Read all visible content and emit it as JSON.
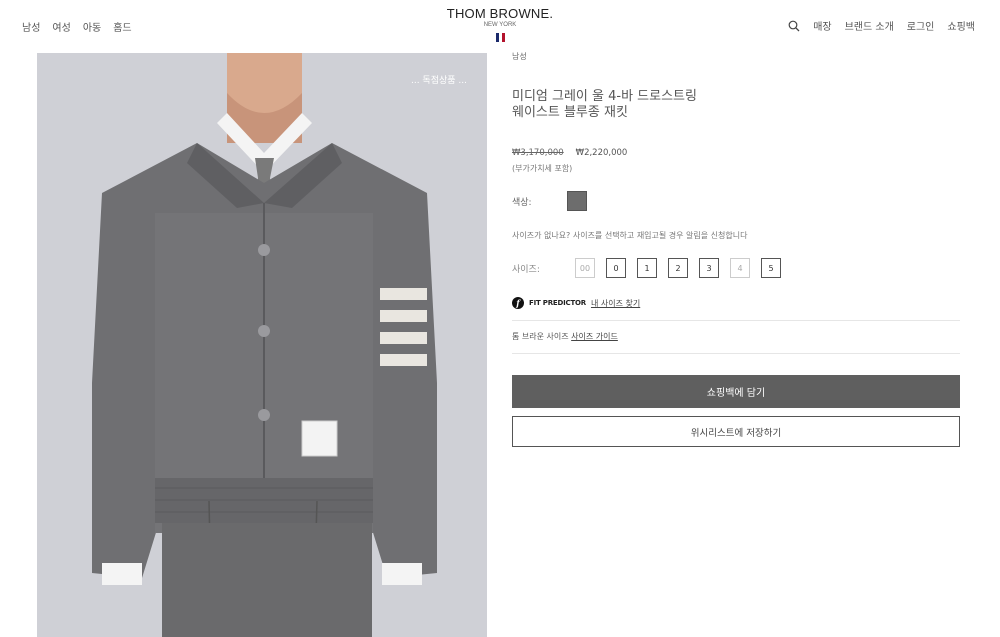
{
  "header": {
    "nav_left": [
      "남성",
      "여성",
      "아동",
      "홈드"
    ],
    "logo_main": "THOM BROWNE.",
    "logo_sub": "NEW YORK",
    "nav_right": [
      "매장",
      "브랜드 소개",
      "로그인",
      "쇼핑백"
    ]
  },
  "image": {
    "tag": "... 독점상품 ..."
  },
  "product": {
    "breadcrumb": "남성",
    "title": "미디엄 그레이 울 4-바 드로스트링 웨이스트 블루종 재킷",
    "price_old": "₩3,170,000",
    "price_new": "₩2,220,000",
    "vat_note": "(부가가치세 포함)",
    "color_label": "색상:",
    "color_swatch": "#6d6d6d",
    "restock_note": "사이즈가 없나요? 사이즈를 선택하고 재입고될 경우 알림을 신청합니다",
    "size_label": "사이즈:",
    "sizes": [
      {
        "label": "00",
        "available": false
      },
      {
        "label": "0",
        "available": true
      },
      {
        "label": "1",
        "available": true
      },
      {
        "label": "2",
        "available": true
      },
      {
        "label": "3",
        "available": true
      },
      {
        "label": "4",
        "available": false
      },
      {
        "label": "5",
        "available": true
      }
    ],
    "fit_predictor": "FIT PREDICTOR",
    "fit_link": "내 사이즈 찾기",
    "size_guide_prefix": "톰 브라운 사이즈",
    "size_guide_link": "사이즈 가이드",
    "cart_button": "쇼핑백에 담기",
    "wishlist_button": "위시리스트에 저장하기"
  },
  "colors": {
    "accent": "#5f5f5f",
    "flag_blue": "#1b2a6b",
    "flag_red": "#b3122c"
  }
}
